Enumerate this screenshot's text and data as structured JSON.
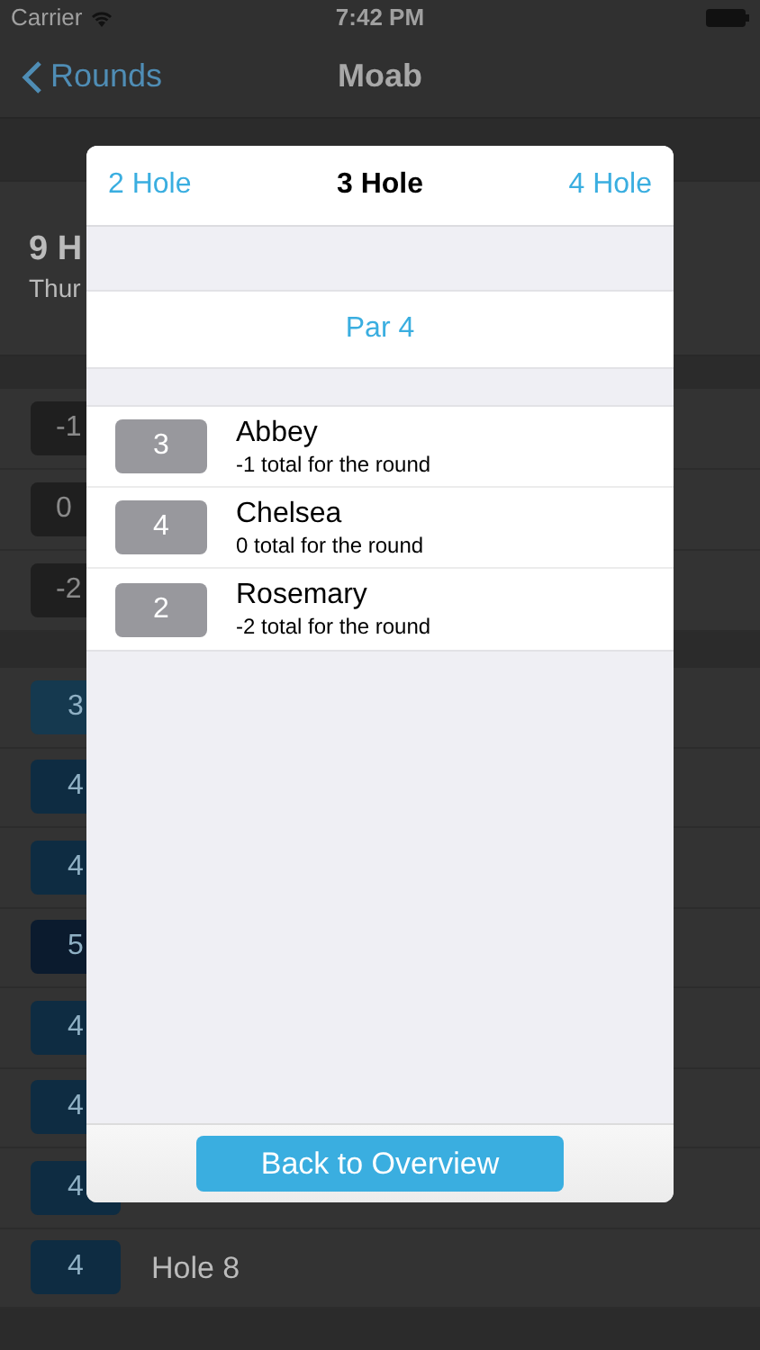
{
  "status_bar": {
    "carrier": "Carrier",
    "time": "7:42 PM"
  },
  "nav": {
    "back": "Rounds",
    "title": "Moab"
  },
  "header": {
    "title": "9 H",
    "subtitle": "Thur"
  },
  "scores": [
    {
      "value": "-1"
    },
    {
      "value": "0"
    },
    {
      "value": "-2"
    }
  ],
  "holes": [
    {
      "score": "3",
      "color": "#15394f"
    },
    {
      "score": "4",
      "color": "#0e2c42"
    },
    {
      "score": "4",
      "color": "#0e2c42"
    },
    {
      "score": "5",
      "color": "#0b1b2e"
    },
    {
      "score": "4",
      "color": "#0e2c42"
    },
    {
      "score": "4",
      "color": "#0e2c42"
    },
    {
      "score": "4",
      "color": "#0e2c42"
    },
    {
      "score": "4",
      "color": "#0e2c42",
      "label": "Hole 8"
    }
  ],
  "modal": {
    "prev": "2 Hole",
    "title": "3 Hole",
    "next": "4 Hole",
    "par": "Par 4",
    "players": [
      {
        "score": "3",
        "name": "Abbey",
        "detail": "-1 total for the round"
      },
      {
        "score": "4",
        "name": "Chelsea",
        "detail": "0 total for the round"
      },
      {
        "score": "2",
        "name": "Rosemary",
        "detail": "-2 total for the round"
      }
    ],
    "button": "Back to Overview"
  }
}
